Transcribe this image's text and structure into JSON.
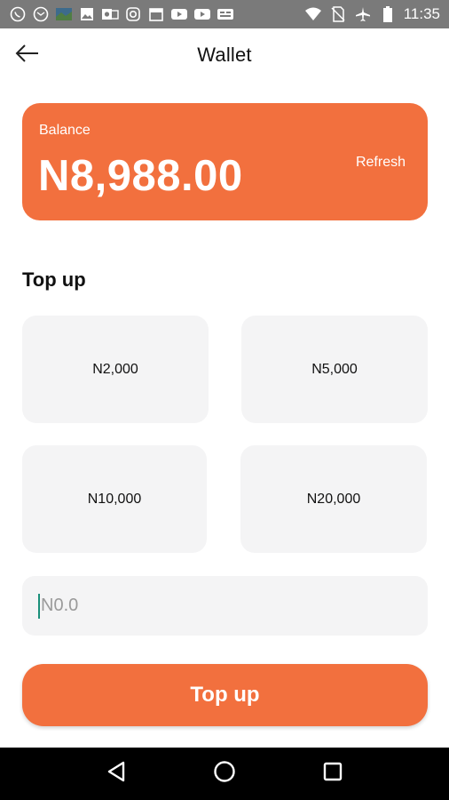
{
  "status_bar": {
    "time": "11:35",
    "left_icons": [
      "whatsapp-icon",
      "email-icon",
      "photo-thumbnail-icon",
      "image-icon",
      "outlook-icon",
      "instagram-icon",
      "calendar-icon",
      "youtube-icon",
      "youtube-icon",
      "message-icon"
    ],
    "right_icons": [
      "wifi-icon",
      "no-sim-icon",
      "airplane-icon",
      "battery-icon"
    ]
  },
  "header": {
    "title": "Wallet",
    "back_icon": "arrow-left-icon"
  },
  "balance": {
    "label": "Balance",
    "amount": "N8,988.00",
    "refresh_label": "Refresh"
  },
  "topup": {
    "section_title": "Top up",
    "amounts": [
      "N2,000",
      "N5,000",
      "N10,000",
      "N20,000"
    ],
    "input_placeholder": "N0.0",
    "input_value": "",
    "button_label": "Top up"
  },
  "nav": {
    "items": [
      "back-triangle-icon",
      "home-circle-icon",
      "recents-square-icon"
    ]
  },
  "colors": {
    "accent": "#f2703e",
    "tile_bg": "#f4f4f5",
    "status_bar": "#7a7a7a",
    "nav_bar": "#000000"
  }
}
